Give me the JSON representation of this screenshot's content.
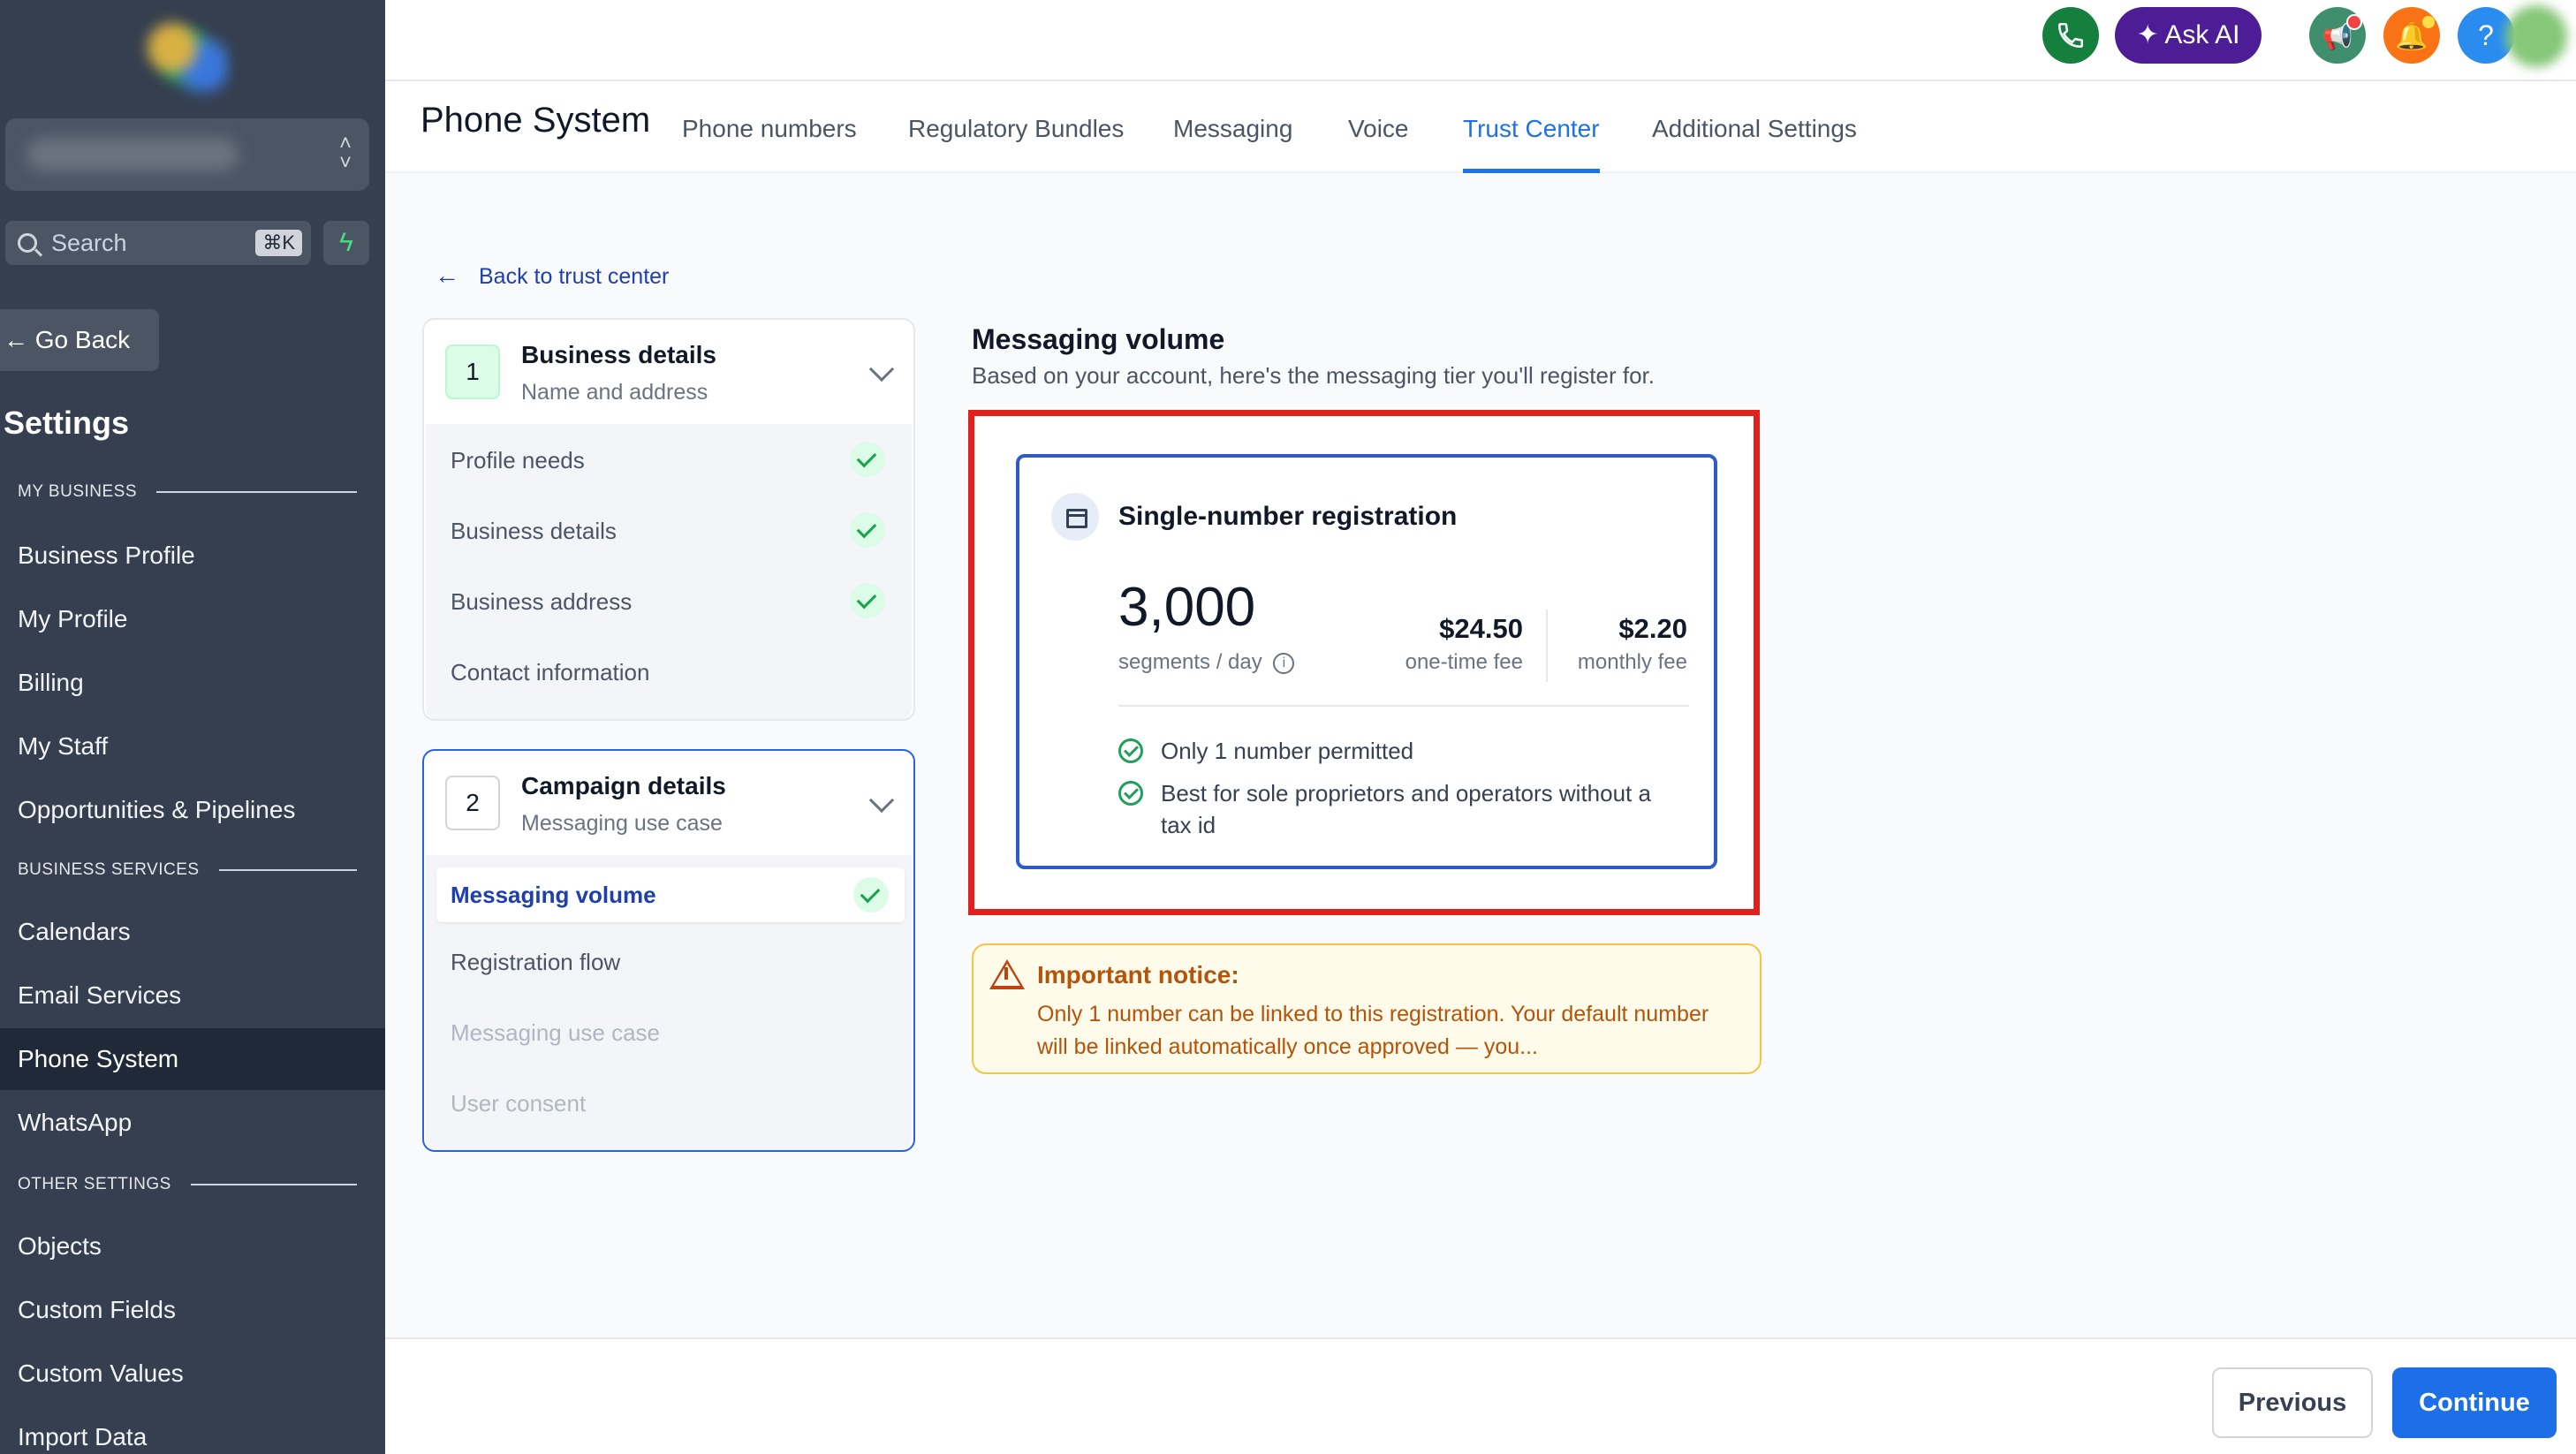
{
  "sidebar": {
    "search_placeholder": "Search",
    "search_shortcut": "⌘K",
    "go_back": "Go Back",
    "settings_title": "Settings",
    "sections": {
      "my_business": "MY BUSINESS",
      "business_services": "BUSINESS SERVICES",
      "other_settings": "OTHER SETTINGS"
    },
    "items": [
      {
        "label": "Business Profile"
      },
      {
        "label": "My Profile"
      },
      {
        "label": "Billing"
      },
      {
        "label": "My Staff"
      },
      {
        "label": "Opportunities & Pipelines"
      },
      {
        "label": "Calendars"
      },
      {
        "label": "Email Services"
      },
      {
        "label": "Phone System",
        "active": true
      },
      {
        "label": "WhatsApp"
      },
      {
        "label": "Objects"
      },
      {
        "label": "Custom Fields"
      },
      {
        "label": "Custom Values"
      },
      {
        "label": "Import Data"
      }
    ]
  },
  "topbar": {
    "ask_ai": "Ask AI",
    "help": "?",
    "icons": [
      "phone-icon",
      "sparkle-icon",
      "megaphone-icon",
      "bell-icon",
      "help-icon",
      "avatar"
    ]
  },
  "header": {
    "title": "Phone System",
    "tabs": [
      {
        "label": "Phone numbers"
      },
      {
        "label": "Regulatory Bundles"
      },
      {
        "label": "Messaging"
      },
      {
        "label": "Voice"
      },
      {
        "label": "Trust Center",
        "active": true
      },
      {
        "label": "Additional Settings"
      }
    ]
  },
  "back_link": "Back to trust center",
  "steps": [
    {
      "number": "1",
      "title": "Business details",
      "subtitle": "Name and address",
      "substeps": [
        {
          "label": "Profile needs",
          "done": true
        },
        {
          "label": "Business details",
          "done": true
        },
        {
          "label": "Business address",
          "done": true
        },
        {
          "label": "Contact information",
          "done": false
        }
      ]
    },
    {
      "number": "2",
      "title": "Campaign details",
      "subtitle": "Messaging use case",
      "substeps": [
        {
          "label": "Messaging volume",
          "done": true,
          "current": true
        },
        {
          "label": "Registration flow",
          "done": false
        },
        {
          "label": "Messaging use case",
          "done": false,
          "disabled": true
        },
        {
          "label": "User consent",
          "done": false,
          "disabled": true
        }
      ]
    }
  ],
  "messaging_volume": {
    "title": "Messaging volume",
    "subtitle": "Based on your account, here's the messaging tier you'll register for.",
    "tier": {
      "name": "Single-number registration",
      "segments": "3,000",
      "segments_label": "segments / day",
      "one_time_fee": "$24.50",
      "one_time_label": "one-time fee",
      "monthly_fee": "$2.20",
      "monthly_label": "monthly fee",
      "features": [
        "Only 1 number permitted",
        "Best for sole proprietors and operators without a tax id"
      ]
    },
    "notice": {
      "title": "Important notice:",
      "body": "Only 1 number can be linked to this registration. Your default number will be linked automatically once approved — you..."
    }
  },
  "footer": {
    "previous": "Previous",
    "continue": "Continue"
  },
  "colors": {
    "sidebar_bg": "#353f4f",
    "accent": "#1d72e8",
    "highlight_border": "#e0201b",
    "success": "#16a34a",
    "warning": "#b45309"
  }
}
